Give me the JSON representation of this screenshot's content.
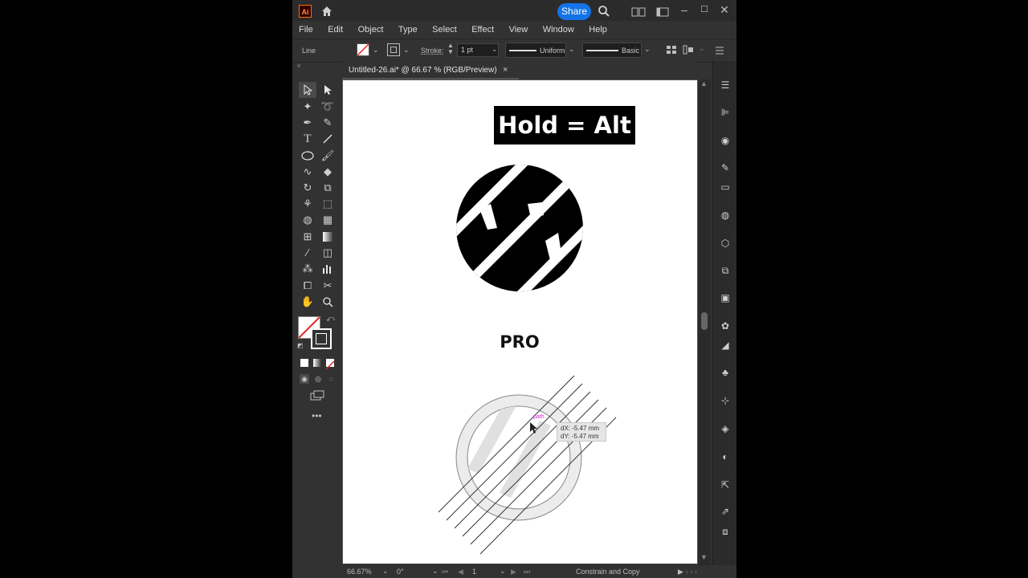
{
  "app": {
    "logo": "Ai",
    "share_label": "Share",
    "menu": [
      "File",
      "Edit",
      "Object",
      "Type",
      "Select",
      "Effect",
      "View",
      "Window",
      "Help"
    ]
  },
  "control_bar": {
    "selection_type": "Line",
    "stroke_label": "Stroke:",
    "stroke_weight": "1 pt",
    "profile_label": "Uniform",
    "brush_label": "Basic"
  },
  "document": {
    "tab_title": "Untitled-26.ai* @ 66.67 % (RGB/Preview)",
    "tab_close": "×"
  },
  "artboard": {
    "overlay_title": "Hold = Alt",
    "brand_text": "PRO",
    "path_label": "path",
    "tooltip_dx": "dX: -5.47 mm",
    "tooltip_dy": "dY: -5.47 mm"
  },
  "status_bar": {
    "zoom": "66.67%",
    "rotation": "0°",
    "artboard_number": "1",
    "status_text": "Constrain and Copy"
  },
  "colors": {
    "share_button": "#1473e6",
    "app_background": "#323232",
    "canvas": "#535353",
    "artboard": "#ffffff",
    "tooltip_path_label": "#e020e0"
  },
  "icons": {
    "toolbar": [
      "selection-tool-icon",
      "direct-selection-tool-icon",
      "magic-wand-icon",
      "lasso-icon",
      "pen-icon",
      "curvature-icon",
      "type-icon",
      "line-segment-icon",
      "ellipse-icon",
      "paintbrush-icon",
      "shaper-icon",
      "eraser-icon",
      "rotate-icon",
      "scale-icon",
      "warp-icon",
      "free-transform-icon",
      "shape-builder-icon",
      "perspective-grid-icon",
      "mesh-icon",
      "gradient-icon",
      "eyedropper-icon",
      "blend-icon",
      "symbol-sprayer-icon",
      "column-graph-icon",
      "artboard-icon",
      "slice-icon",
      "hand-icon",
      "zoom-icon"
    ],
    "right_panel": [
      "properties-icon",
      "align-icon",
      "appearance-icon",
      "brushes-icon",
      "gradient-panel-icon",
      "color-guide-icon",
      "3d-icon",
      "transparency-icon",
      "libraries-icon",
      "color-icon",
      "swatches-icon",
      "symbols-icon",
      "transform-icon",
      "layers-icon",
      "pathfinder-icon",
      "export-icon",
      "links-icon",
      "artboards-icon"
    ]
  }
}
